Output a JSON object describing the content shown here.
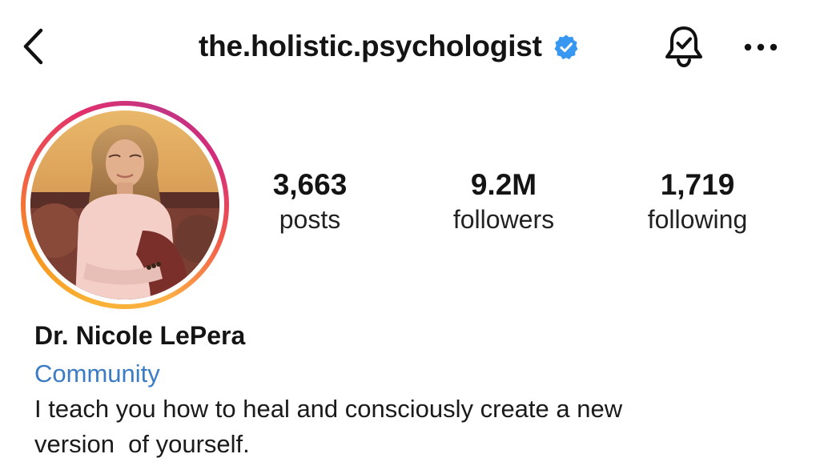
{
  "header": {
    "username": "the.holistic.psychologist",
    "back_icon": "chevron-left-icon",
    "verified_icon": "verified-badge-icon",
    "verified_color": "#3897f0",
    "bell_icon": "bell-check-icon",
    "more_icon": "more-horizontal-icon"
  },
  "profile": {
    "avatar_icon": "profile-avatar",
    "ring_colors": [
      "#f9b233",
      "#f15a4a",
      "#e1306c",
      "#c13584"
    ]
  },
  "stats": {
    "posts": {
      "value": "3,663",
      "label": "posts"
    },
    "followers": {
      "value": "9.2M",
      "label": "followers"
    },
    "following": {
      "value": "1,719",
      "label": "following"
    }
  },
  "bio": {
    "name": "Dr. Nicole LePera",
    "category": "Community",
    "category_color": "#3b7cc4",
    "text": "I teach you how to heal and consciously create a new\nversion  of yourself."
  }
}
